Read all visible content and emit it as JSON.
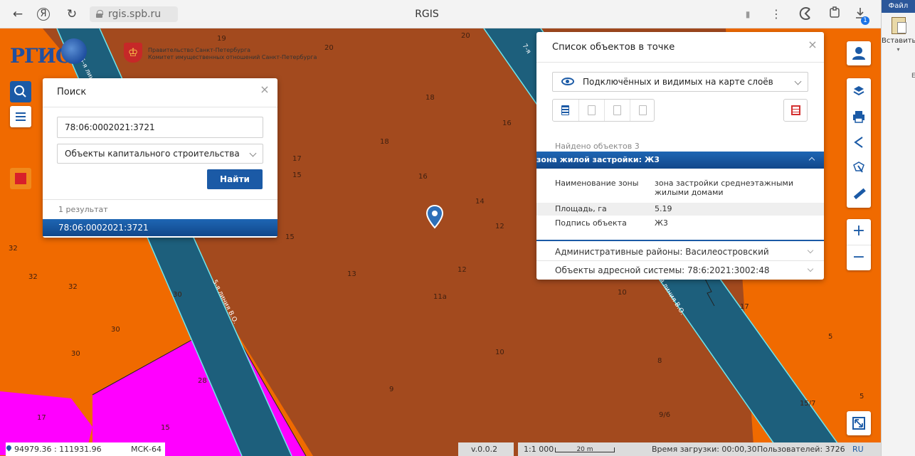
{
  "browser": {
    "back_glyph": "←",
    "yandex_glyph": "Я",
    "reload_glyph": "↻",
    "url": "rgis.spb.ru",
    "tab_title": "RGIS",
    "bookmark_glyph": "▮",
    "menu_glyph": "⋮",
    "downloads_badge": "1"
  },
  "office": {
    "tab": "Файл",
    "paste_label": "Вставить",
    "side_letter": "Е"
  },
  "logo": {
    "text": "РГИС",
    "gov_line1": "Правительство Санкт-Петербурга",
    "gov_line2": "Комитет имущественных отношений Санкт-Петербурга"
  },
  "map_labels": [
    {
      "t": "19"
    },
    {
      "t": "20"
    },
    {
      "t": "20"
    },
    {
      "t": "18"
    },
    {
      "t": "16"
    },
    {
      "t": "18"
    },
    {
      "t": "17"
    },
    {
      "t": "15"
    },
    {
      "t": "16"
    },
    {
      "t": "14"
    },
    {
      "t": "12"
    },
    {
      "t": "15"
    },
    {
      "t": "32"
    },
    {
      "t": "32"
    },
    {
      "t": "32"
    },
    {
      "t": "30"
    },
    {
      "t": "13"
    },
    {
      "t": "12"
    },
    {
      "t": "11а"
    },
    {
      "t": "10"
    },
    {
      "t": "17"
    },
    {
      "t": "30"
    },
    {
      "t": "30"
    },
    {
      "t": "5"
    },
    {
      "t": "10"
    },
    {
      "t": "8"
    },
    {
      "t": "28"
    },
    {
      "t": "9"
    },
    {
      "t": "5"
    },
    {
      "t": "15/7"
    },
    {
      "t": "17"
    },
    {
      "t": "15"
    },
    {
      "t": "9/6"
    }
  ],
  "streets": {
    "left": "5-я линия В.О.",
    "left_top": "5-я лин",
    "right": "7-я линия В.О.",
    "right_top": "7-я"
  },
  "search_panel": {
    "title": "Поиск",
    "close_glyph": "×",
    "query": "78:06:0002021:3721",
    "query_placeholder": "",
    "object_type": "Объекты капитального строительства",
    "find_label": "Найти",
    "result_count": "1 результат",
    "results": [
      "78:06:0002021:3721"
    ]
  },
  "objects_panel": {
    "title": "Список объектов в точке",
    "close_glyph": "×",
    "layers_select": "Подключённых и видимых на карте слоёв",
    "found": "Найдено объектов 3",
    "zone": {
      "header": "зона жилой застройки: Ж3",
      "props": [
        {
          "k": "Наименование зоны",
          "v": "зона застройки среднеэтажными жилыми домами"
        },
        {
          "k": "Площадь, га",
          "v": "5.19"
        },
        {
          "k": "Подпись объекта",
          "v": "Ж3"
        }
      ]
    },
    "accordion": [
      "Административные районы: Василеостровский",
      "Объекты адресной системы: 78:6:2021:3002:48"
    ]
  },
  "status": {
    "coords": "94979.36 : 111931.96",
    "crs": "МСК-64",
    "version": "v.0.0.2",
    "scale": "1:1 000",
    "scale_bar": "20 m",
    "load_time": "Время загрузки: 00:00,30",
    "users": "Пользователей: 3726",
    "lang": "RU"
  },
  "colors": {
    "accent": "#1b5aa6",
    "zone_brown": "#a34a1e",
    "zone_orange": "#f06a00",
    "zone_magenta": "#ff00ff",
    "street_blue": "#1d5f7c",
    "street_edge": "#6ee6ee"
  }
}
